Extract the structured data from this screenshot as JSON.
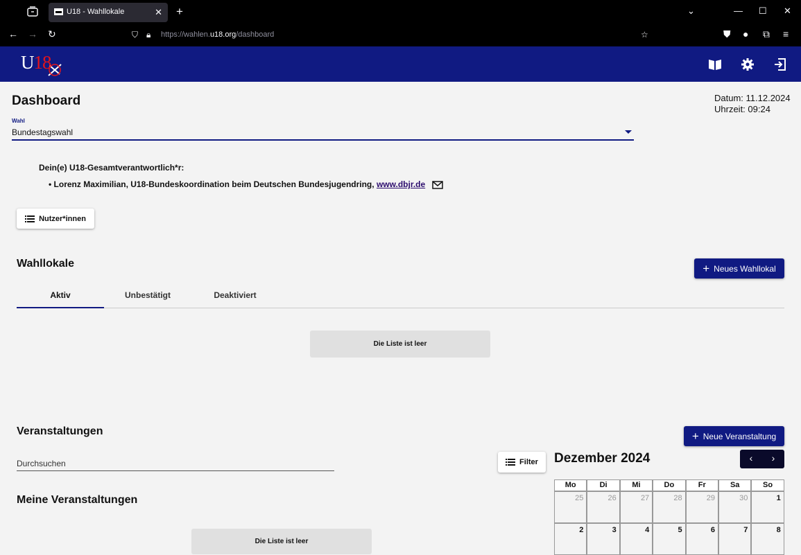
{
  "browser": {
    "tab_title": "U18 - Wahllokale",
    "url_prefix": "https://wahlen.",
    "url_domain": "u18.org",
    "url_path": "/dashboard"
  },
  "header": {
    "logo_text_u": "U",
    "logo_text_18": "18"
  },
  "page": {
    "title": "Dashboard",
    "date_label": "Datum: 11.12.2024",
    "time_label": "Uhrzeit: 09:24"
  },
  "election_select": {
    "label": "Wahl",
    "value": "Bundestagswahl"
  },
  "responsible": {
    "title": "Dein(e) U18-Gesamtverantwortlich*r:",
    "person_text": "Lorenz Maximilian, U18-Bundeskoordination beim Deutschen Bundesjugendring,",
    "link_text": "www.dbjr.de"
  },
  "users_button": "Nutzer*innen",
  "wahllokale": {
    "title": "Wahllokale",
    "new_button": "Neues Wahllokal",
    "tabs": [
      {
        "label": "Aktiv",
        "active": true
      },
      {
        "label": "Unbestätigt",
        "active": false
      },
      {
        "label": "Deaktiviert",
        "active": false
      }
    ],
    "empty_text": "Die Liste ist leer"
  },
  "veranstaltungen": {
    "title": "Veranstaltungen",
    "new_button": "Neue Veranstaltung",
    "search_placeholder": "Durchsuchen",
    "filter_button": "Filter",
    "my_title": "Meine Veranstaltungen",
    "empty_text": "Die Liste ist leer"
  },
  "calendar": {
    "month_label": "Dezember 2024",
    "weekdays": [
      "Mo",
      "Di",
      "Mi",
      "Do",
      "Fr",
      "Sa",
      "So"
    ],
    "week1": [
      {
        "day": "25",
        "current": false
      },
      {
        "day": "26",
        "current": false
      },
      {
        "day": "27",
        "current": false
      },
      {
        "day": "28",
        "current": false
      },
      {
        "day": "29",
        "current": false
      },
      {
        "day": "30",
        "current": false
      },
      {
        "day": "1",
        "current": true
      }
    ],
    "week2": [
      {
        "day": "2",
        "current": true
      },
      {
        "day": "3",
        "current": true
      },
      {
        "day": "4",
        "current": true
      },
      {
        "day": "5",
        "current": true
      },
      {
        "day": "6",
        "current": true
      },
      {
        "day": "7",
        "current": true
      },
      {
        "day": "8",
        "current": true
      }
    ]
  },
  "colors": {
    "brand_navy": "#101a82",
    "logo_red": "#e4141b"
  }
}
